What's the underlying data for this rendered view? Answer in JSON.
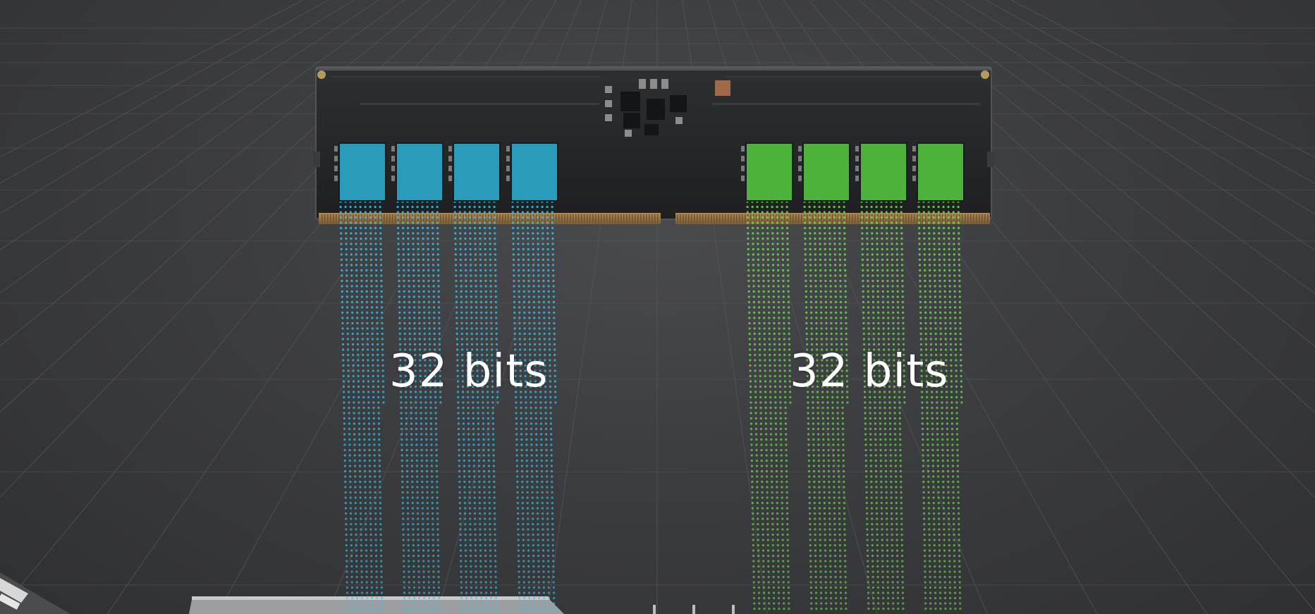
{
  "scene": {
    "left_label": "32 bits",
    "right_label": "32 bits",
    "left_color": "#2a9bbb",
    "right_color": "#4db23c",
    "left_dot_color": "#38c4e8",
    "right_dot_color": "#6fe04f",
    "background_color": "#3a3b3d"
  }
}
